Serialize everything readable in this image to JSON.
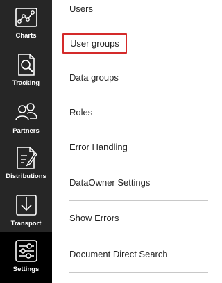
{
  "sidebar": {
    "items": [
      {
        "label": "Charts",
        "icon": "charts-icon",
        "active": false
      },
      {
        "label": "Tracking",
        "icon": "tracking-icon",
        "active": false
      },
      {
        "label": "Partners",
        "icon": "partners-icon",
        "active": false
      },
      {
        "label": "Distributions",
        "icon": "distributions-icon",
        "active": false
      },
      {
        "label": "Transport",
        "icon": "transport-icon",
        "active": false
      },
      {
        "label": "Settings",
        "icon": "settings-icon",
        "active": true
      }
    ]
  },
  "menu": {
    "items": [
      {
        "label": "Users"
      },
      {
        "label": "User groups",
        "highlighted": true
      },
      {
        "label": "Data groups"
      },
      {
        "label": "Roles"
      },
      {
        "label": "Error Handling"
      },
      {
        "label": "DataOwner Settings"
      },
      {
        "label": "Show Errors"
      },
      {
        "label": "Document Direct Search"
      }
    ]
  },
  "colors": {
    "sidebar_bg": "#262626",
    "sidebar_active_bg": "#000000",
    "highlight_border": "#d42a2a"
  }
}
